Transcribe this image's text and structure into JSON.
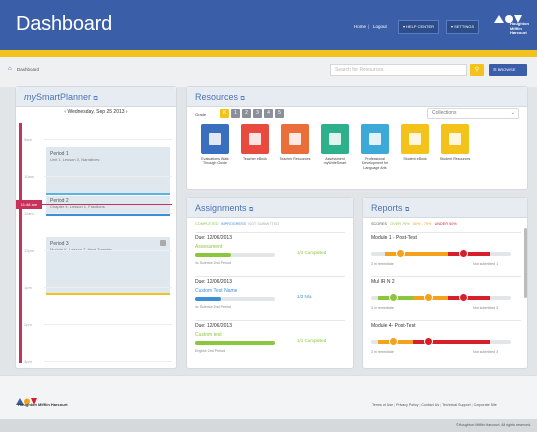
{
  "header": {
    "title": "Dashboard",
    "home": "Home",
    "logout": "Logout",
    "help": "HELP CENTER",
    "settings": "SETTINGS",
    "brand": [
      "Houghton",
      "Mifflin",
      "Harcourt"
    ]
  },
  "subbar": {
    "crumb": "Dashboard",
    "search_placeholder": "Search for Resources",
    "browse": "BROWSE"
  },
  "planner": {
    "title_em": "my",
    "title": "SmartPlanner",
    "date": "Wednesday, Sep 25 2013",
    "times": [
      "9am",
      "10am",
      "11am",
      "12pm",
      "1pm",
      "2pm",
      "3pm"
    ],
    "now": "11:48 am",
    "periods": [
      {
        "name": "Period 1",
        "desc": "Unit 1, Lesson 3, Narratives"
      },
      {
        "name": "Period 2",
        "desc": "Chapter 4, Lesson 1, Fractions"
      },
      {
        "name": "Period 3",
        "desc": "Module K, Lesson 7, Heat Transfer"
      }
    ]
  },
  "resources": {
    "title": "Resources",
    "grade_label": "Grade",
    "grades": [
      "K",
      "1",
      "2",
      "3",
      "4",
      "5"
    ],
    "collections": "Collections",
    "items": [
      {
        "label": "Evaluations Walk Through Guide",
        "color": "#3a6fbf"
      },
      {
        "label": "Teacher eBook",
        "color": "#e94a3f"
      },
      {
        "label": "Teacher Resources",
        "color": "#ea6e3a"
      },
      {
        "label": "Assessment myWriteSmart",
        "color": "#2fb08d"
      },
      {
        "label": "Professional Development for Language Arts",
        "color": "#3da9d8"
      },
      {
        "label": "Student eBook",
        "color": "#f3c21b"
      },
      {
        "label": "Student Resources",
        "color": "#f3c21b"
      }
    ]
  },
  "assignments": {
    "title": "Assignments",
    "filters": [
      "COMPLETED",
      "INPROGRESS",
      "NOT SUBMITTED"
    ],
    "items": [
      {
        "due": "Due: 12/06/2013",
        "name": "Assessment",
        "class": "4c Science 2nd Period",
        "status": "1/2 Completed",
        "progress": 0.45
      },
      {
        "due": "Due: 12/06/2013",
        "name": "Custom Test Name",
        "class": "4c Science 2nd Period",
        "status": "1/3 N/a",
        "progress": 0.33
      },
      {
        "due": "Due: 12/06/2013",
        "name": "Custom test",
        "class": "English 2nd Period",
        "status": "1/1 Completed",
        "progress": 1.0
      }
    ]
  },
  "reports": {
    "title": "Reports",
    "scores_label": "SCORES",
    "legend": [
      "OVER 79%",
      "50% - 79%",
      "UNDER 50%"
    ],
    "items": [
      {
        "name": "Module 1 - Post-Test",
        "ret": "3 in remediate",
        "sub": "Not submitted 1"
      },
      {
        "name": "Mul IR N 2",
        "ret": "3 in remediate",
        "sub": "Not submitted 3"
      },
      {
        "name": "Module 4- Post-Test",
        "ret": "3 in remediate",
        "sub": "Not submitted 3"
      }
    ]
  },
  "footer": {
    "brand": "Houghton Mifflin Harcourt",
    "links": [
      "Terms of Use",
      "Privacy Policy",
      "Contact Us",
      "Technical Support",
      "Corporate Site"
    ],
    "copyright": "©Houghton Mifflin Harcourt. All rights reserved."
  },
  "colors": {
    "blue": "#3a5fa8",
    "yellow": "#f3c21b",
    "green": "#8cc63f",
    "red": "#d71f2a",
    "orange": "#f3a31b"
  }
}
